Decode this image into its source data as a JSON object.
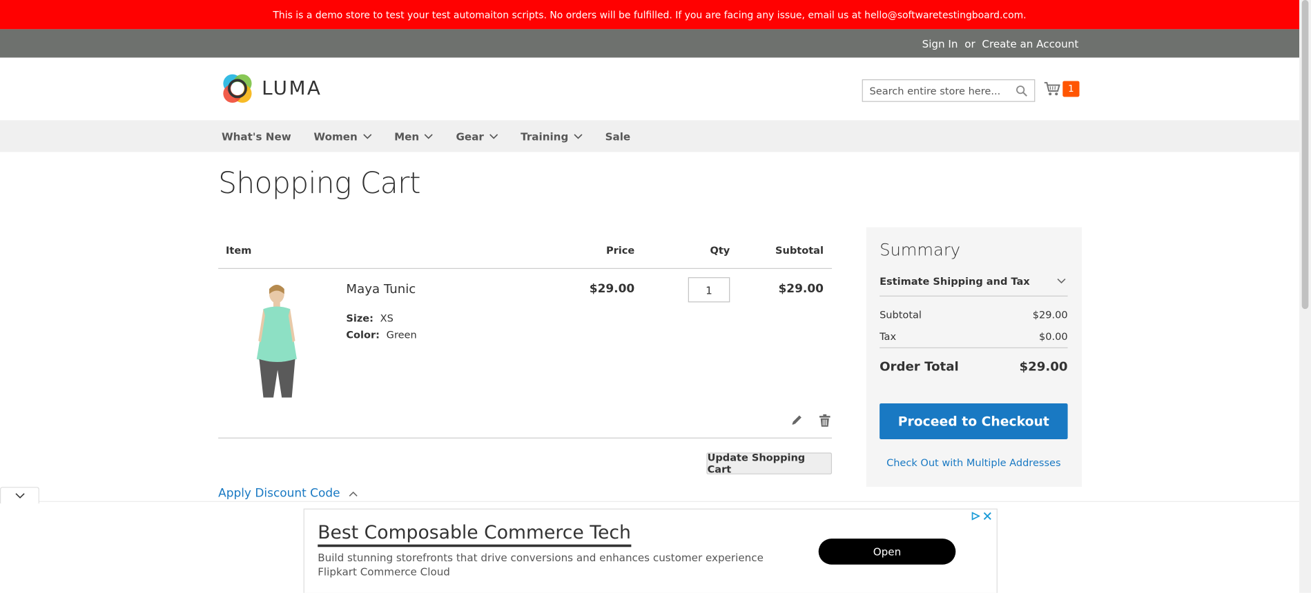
{
  "demo_notice": "This is a demo store to test your test automaiton scripts. No orders will be fulfilled. If you are facing any issue, email us at hello@softwaretestingboard.com.",
  "header": {
    "sign_in": "Sign In",
    "or": "or",
    "create_account": "Create an Account",
    "logo_text": "LUMA",
    "search_placeholder": "Search entire store here...",
    "cart_count": "1"
  },
  "nav": {
    "items": [
      "What's New",
      "Women",
      "Men",
      "Gear",
      "Training",
      "Sale"
    ]
  },
  "page_title": "Shopping Cart",
  "cart": {
    "columns": {
      "item": "Item",
      "price": "Price",
      "qty": "Qty",
      "subtotal": "Subtotal"
    },
    "items": [
      {
        "name": "Maya Tunic",
        "size_label": "Size:",
        "size": "XS",
        "color_label": "Color:",
        "color": "Green",
        "price": "$29.00",
        "qty": "1",
        "subtotal": "$29.00"
      }
    ],
    "update_button": "Update Shopping Cart",
    "discount_label": "Apply Discount Code"
  },
  "summary": {
    "title": "Summary",
    "estimate": "Estimate Shipping and Tax",
    "subtotal_label": "Subtotal",
    "subtotal": "$29.00",
    "tax_label": "Tax",
    "tax": "$0.00",
    "order_total_label": "Order Total",
    "order_total": "$29.00",
    "checkout_button": "Proceed to Checkout",
    "multi_address": "Check Out with Multiple Addresses"
  },
  "ad": {
    "title": "Best Composable Commerce Tech",
    "description": "Build stunning storefronts that drive conversions and enhances customer experience",
    "brand": "Flipkart Commerce Cloud",
    "button": "Open"
  },
  "colors": {
    "demo_bar": "#ff0101",
    "header_top": "#6e716e",
    "primary": "#1979c3",
    "cart_badge": "#ff5501"
  }
}
